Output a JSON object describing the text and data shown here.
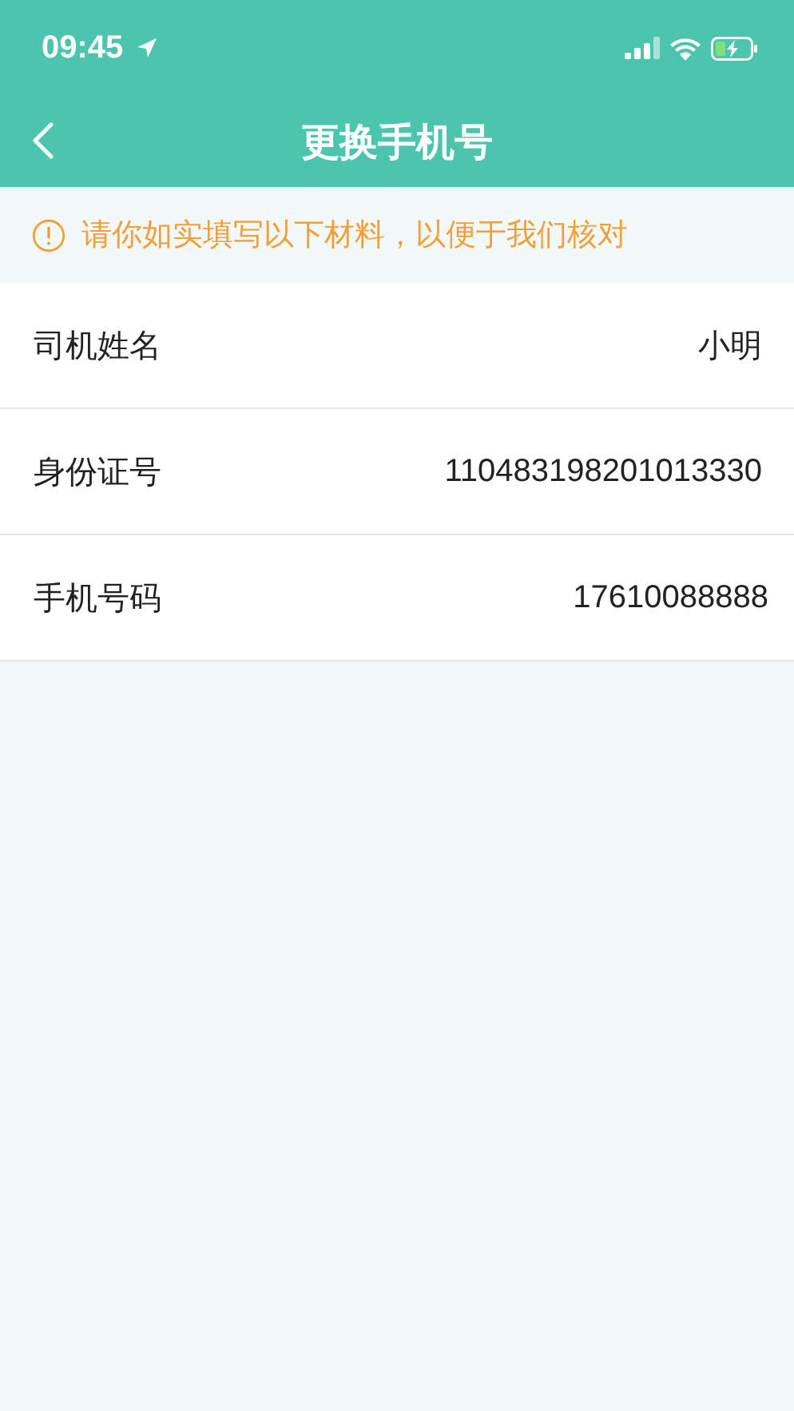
{
  "status_bar": {
    "time": "09:45"
  },
  "nav": {
    "title": "更换手机号"
  },
  "notice": {
    "text": "请你如实填写以下材料，以便于我们核对"
  },
  "rows": [
    {
      "label": "司机姓名",
      "value": "小明"
    },
    {
      "label": "身份证号",
      "value": "110483198201013330"
    },
    {
      "label": "手机号码",
      "value": "17610088888"
    }
  ]
}
